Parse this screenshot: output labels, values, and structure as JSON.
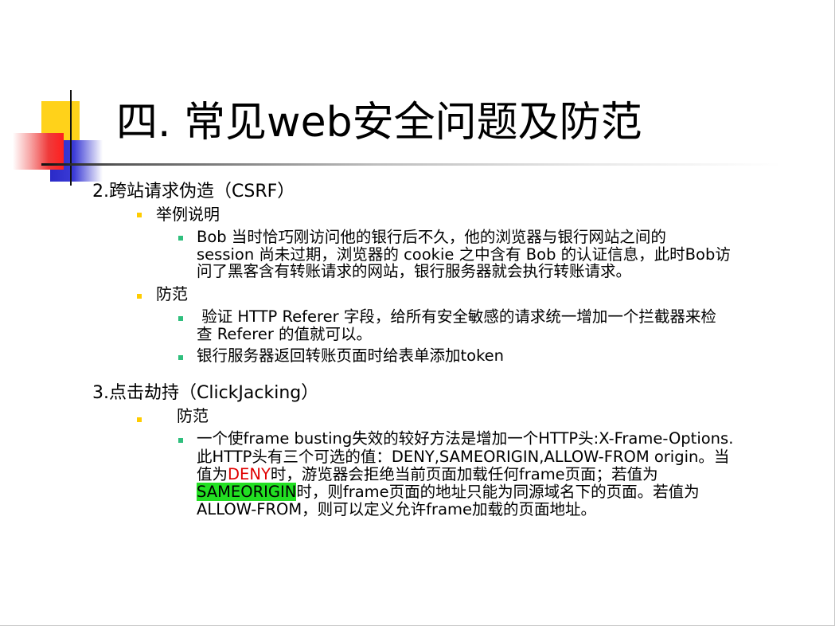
{
  "slide": {
    "title": "四. 常见web安全问题及防范",
    "sections": [
      {
        "heading": "2.跨站请求伪造（CSRF）",
        "items": [
          {
            "label": "举例说明",
            "bullets": [
              {
                "lines": [
                  "Bob 当时恰巧刚访问他的银行后不久，他的浏览器与银行网站之间的",
                  "session 尚未过期，浏览器的 cookie 之中含有 Bob 的认证信息，此时Bob访",
                  "问了黑客含有转账请求的网站，银行服务器就会执行转账请求。"
                ]
              }
            ]
          },
          {
            "label": "防范",
            "bullets": [
              {
                "lines": [
                  " 验证 HTTP Referer 字段，给所有安全敏感的请求统一增加一个拦截器来检",
                  "查 Referer 的值就可以。"
                ]
              },
              {
                "lines": [
                  "银行服务器返回转账页面时给表单添加token"
                ]
              }
            ]
          }
        ]
      },
      {
        "heading": "3.点击劫持（ClickJacking）",
        "items": [
          {
            "label": "防范",
            "bullets": [
              {
                "line1": "一个使frame busting失效的较好方法是增加一个HTTP头:X-Frame-Options.",
                "line2": "此HTTP头有三个可选的值：DENY,SAMEORIGIN,ALLOW-FROM origin。当",
                "line3_a": "值为",
                "line3_deny": "DENY",
                "line3_b": "时，游览器会拒绝当前页面加载任何frame页面；若值为",
                "line4_sameorigin": "SAMEORIGIN",
                "line4_b": "时，则frame页面的地址只能为同源域名下的页面。若值为",
                "line5": "ALLOW-FROM，则可以定义允许frame加载的页面地址。"
              }
            ]
          }
        ]
      }
    ]
  },
  "colors": {
    "deny_text": "#e00000",
    "sameorigin_highlight": "#22e022",
    "level1_bullet": "#ffcc00",
    "level2_bullet": "#2fbf7d"
  }
}
